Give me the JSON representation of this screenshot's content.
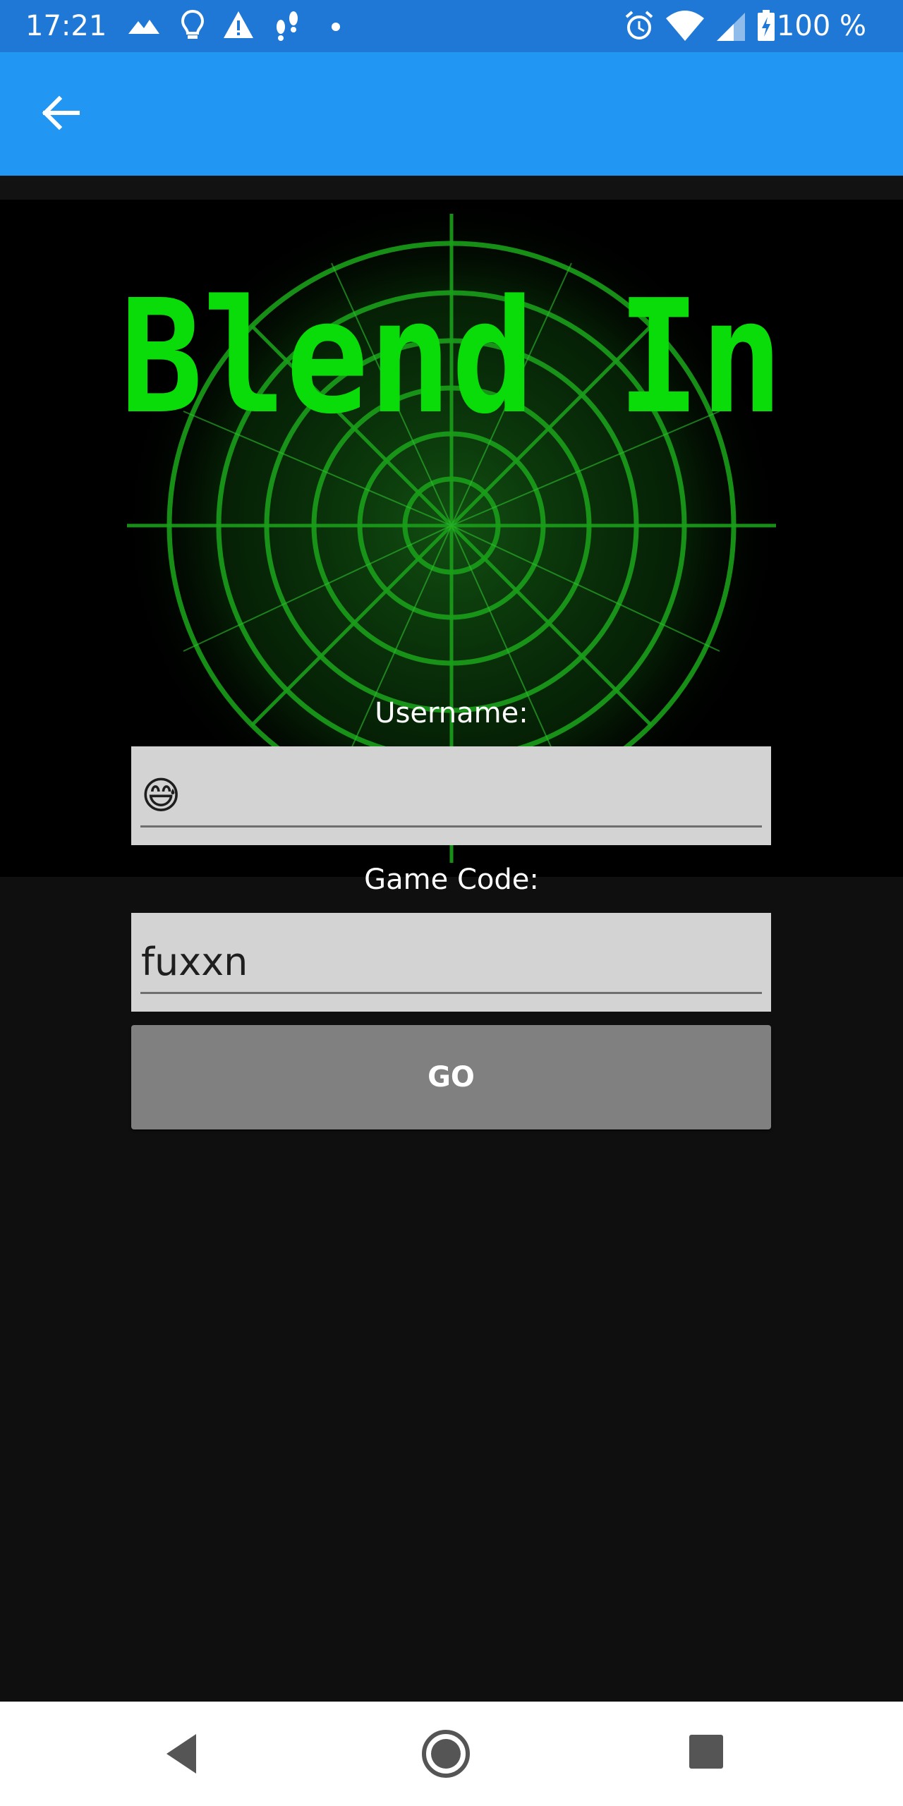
{
  "status_bar": {
    "time": "17:21",
    "battery": "100 %",
    "icons_left": [
      "mountain-icon",
      "lightbulb-icon",
      "warning-icon",
      "footsteps-icon",
      "dot-icon"
    ],
    "icons_right": [
      "alarm-icon",
      "wifi-icon",
      "signal-icon",
      "battery-charging-icon"
    ]
  },
  "app_bar": {
    "back_icon": "arrow-left-icon"
  },
  "hero": {
    "title": "Blend In"
  },
  "form": {
    "username_label": "Username:",
    "username_value": "😅",
    "game_code_label": "Game Code:",
    "game_code_value": "fuxxn",
    "go_label": "GO"
  },
  "colors": {
    "status_bar": "#1f78d6",
    "app_bar": "#2196f3",
    "background": "#0f0f0f",
    "title_green": "#0adc0a",
    "radar_green": "#1a9e1a",
    "field_bg": "#d3d3d3",
    "button_bg": "#808080"
  },
  "nav_bar": {
    "icons": [
      "back-triangle-icon",
      "home-circle-icon",
      "recents-square-icon"
    ]
  }
}
